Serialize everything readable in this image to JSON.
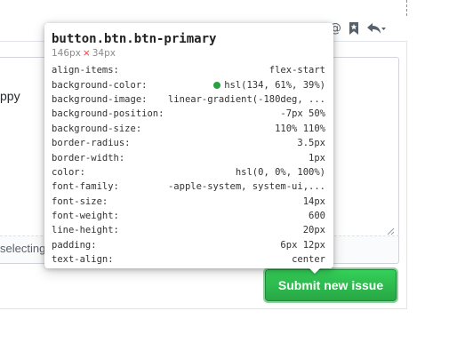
{
  "toolbar": {
    "mention_glyph": "@",
    "icons": [
      "mention-icon",
      "bookmark-icon",
      "reply-icon"
    ]
  },
  "editor": {
    "visible_text": "ppy"
  },
  "attach": {
    "visible_text": "selecting"
  },
  "submit_button": {
    "label": "Submit new issue",
    "bg": "#2ea44f"
  },
  "inspector": {
    "selector": "button.btn.btn-primary",
    "width": "146px",
    "times": "×",
    "height": "34px",
    "rows": [
      {
        "prop": "align-items:",
        "value": "flex-start"
      },
      {
        "prop": "background-color:",
        "value": "hsl(134, 61%, 39%)",
        "swatch": "#27a144"
      },
      {
        "prop": "background-image:",
        "value": "linear-gradient(-180deg, ..."
      },
      {
        "prop": "background-position:",
        "value": "-7px 50%"
      },
      {
        "prop": "background-size:",
        "value": "110% 110%"
      },
      {
        "prop": "border-radius:",
        "value": "3.5px"
      },
      {
        "prop": "border-width:",
        "value": "1px"
      },
      {
        "prop": "color:",
        "value": "hsl(0, 0%, 100%)"
      },
      {
        "prop": "font-family:",
        "value": "-apple-system, system-ui,..."
      },
      {
        "prop": "font-size:",
        "value": "14px"
      },
      {
        "prop": "font-weight:",
        "value": "600"
      },
      {
        "prop": "line-height:",
        "value": "20px"
      },
      {
        "prop": "padding:",
        "value": "6px 12px"
      },
      {
        "prop": "text-align:",
        "value": "center"
      }
    ]
  }
}
